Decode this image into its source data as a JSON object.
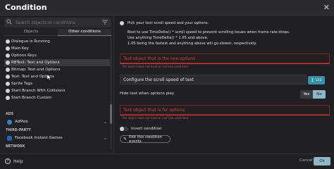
{
  "window": {
    "title": "Condition",
    "close_glyph": "✕"
  },
  "search": {
    "placeholder": "Search objects or conditions"
  },
  "tabs": [
    {
      "label": "Objects",
      "active": false
    },
    {
      "label": "Other conditions",
      "active": true
    }
  ],
  "list": [
    {
      "label": "Dialogue is Running"
    },
    {
      "label": "Main Key"
    },
    {
      "label": "Options Keys"
    },
    {
      "label": "RBText: Text and Options"
    },
    {
      "label": "Bitmap: Text and Options"
    },
    {
      "label": "Text: Text and Options"
    },
    {
      "label": "Sprite Tags"
    },
    {
      "label": "Start Branch With Collisions"
    },
    {
      "label": "Start Branch Custom"
    }
  ],
  "sections": {
    "ads": "ADS",
    "third_party": "THIRD-PARTY",
    "network": "NETWORK"
  },
  "extensions": [
    {
      "label": "AdMob",
      "icon": "admob-icon",
      "color": "#3b82c4"
    },
    {
      "label": "Facebook Instant Games",
      "icon": "facebook-icon",
      "color": "#1e63b8"
    }
  ],
  "details": {
    "heading": "Pick your text scroll speed and your options.",
    "lines": [
      "Best to use TimeDelta() * scroll speed to prevent scrolling issues when frame rate drops.",
      "Use anything TimeDelta() * 1.05 and above.",
      "1.05 being the fastest and anything above will go slower, respectively."
    ],
    "param1": {
      "placeholder": "Text object that is the one options",
      "error": "The object does not exist or can't be used here"
    },
    "param2": {
      "value": "Configure the scroll speed of text"
    },
    "param3": {
      "label": "Hide text when options play",
      "yes": "Yes",
      "no": "No"
    },
    "param4": {
      "placeholder": "Text object that is for options",
      "error": "The object does not exist or can't be used here"
    },
    "invert": "Invert condition",
    "edit_button": "Edit this condition events"
  },
  "footer": {
    "help": "Help",
    "cancel": "Cancel",
    "ok": "Ok"
  },
  "colors": {
    "accent": "#8fb7c6",
    "error": "#d0393a",
    "background": "#1f1f24"
  }
}
